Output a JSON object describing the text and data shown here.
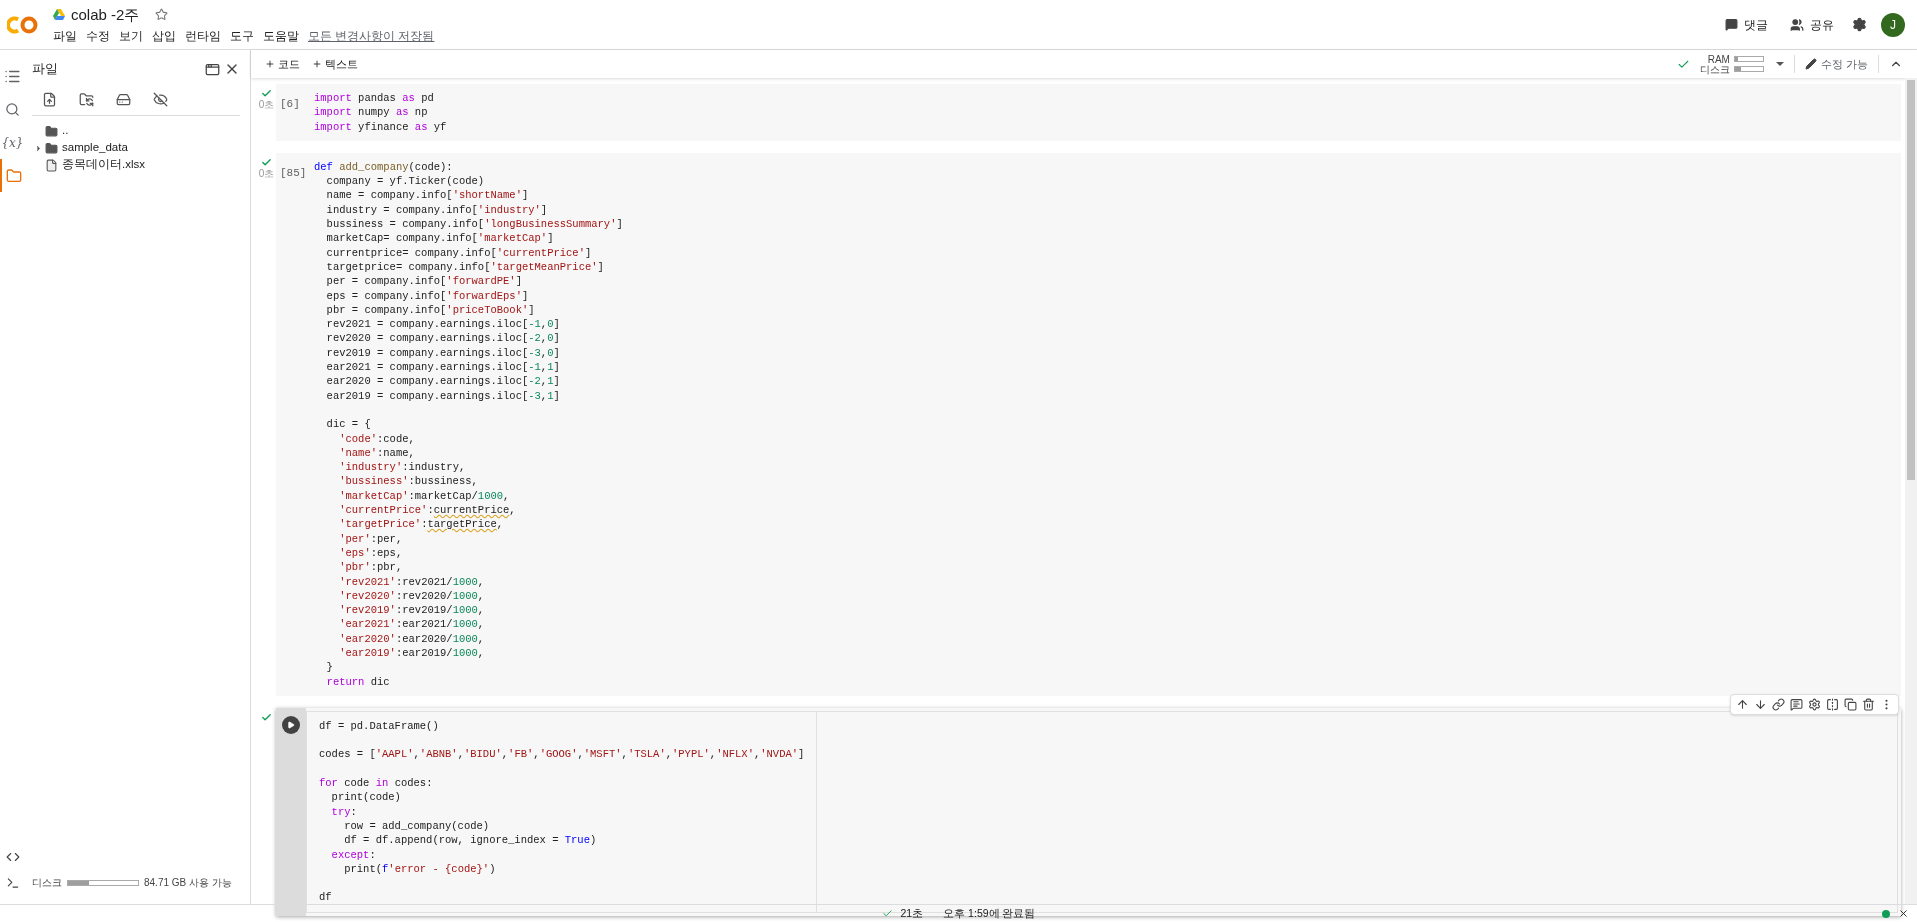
{
  "header": {
    "title": "colab -2주",
    "starred": false,
    "menu": [
      "파일",
      "수정",
      "보기",
      "삽입",
      "런타임",
      "도구",
      "도움말"
    ],
    "save_status": "모든 변경사항이 저장됨",
    "actions": [
      {
        "kind": "comment",
        "label": "댓글"
      },
      {
        "kind": "share",
        "label": "공유"
      }
    ],
    "avatar": "J"
  },
  "rail": [
    {
      "kind": "toc",
      "selected": false
    },
    {
      "kind": "search",
      "selected": false
    },
    {
      "kind": "vars",
      "glyph": "{x}",
      "selected": false
    },
    {
      "kind": "files",
      "selected": true
    }
  ],
  "file_panel": {
    "title": "파일",
    "tree": [
      {
        "kind": "parent",
        "name": ".."
      },
      {
        "kind": "folder",
        "name": "sample_data",
        "expanded": false
      },
      {
        "kind": "file",
        "name": "종목데이터.xlsx"
      }
    ],
    "disk": {
      "label": "디스크",
      "level": 0.3,
      "reading": "84.71 GB 사용 가능"
    }
  },
  "toolbar": {
    "add_buttons": [
      "코드",
      "텍스트"
    ],
    "connected": true,
    "meters": [
      {
        "label": "RAM",
        "level": 0.12
      },
      {
        "label": "디스크",
        "level": 0.2
      }
    ],
    "edit_mode": "수정 가능"
  },
  "cells": [
    {
      "exec": "[6]",
      "ok": true,
      "time": "0초",
      "focused": false,
      "lines": [
        [
          {
            "kind": "kw",
            "text": "import"
          },
          {
            "kind": "plain",
            "text": " pandas "
          },
          {
            "kind": "kw",
            "text": "as"
          },
          {
            "kind": "plain",
            "text": " pd"
          }
        ],
        [
          {
            "kind": "kw",
            "text": "import"
          },
          {
            "kind": "plain",
            "text": " numpy "
          },
          {
            "kind": "kw",
            "text": "as"
          },
          {
            "kind": "plain",
            "text": " np"
          }
        ],
        [
          {
            "kind": "kw",
            "text": "import"
          },
          {
            "kind": "plain",
            "text": " yfinance "
          },
          {
            "kind": "kw",
            "text": "as"
          },
          {
            "kind": "plain",
            "text": " yf"
          }
        ]
      ]
    },
    {
      "exec": "[85]",
      "ok": true,
      "time": "0초",
      "focused": false,
      "lines": [
        [
          {
            "kind": "def",
            "text": "def "
          },
          {
            "kind": "fn",
            "text": "add_company"
          },
          {
            "kind": "plain",
            "text": "(code):"
          }
        ],
        [
          {
            "kind": "plain",
            "text": "  company = yf.Ticker(code)"
          }
        ],
        [
          {
            "kind": "plain",
            "text": "  name = company.info["
          },
          {
            "kind": "str",
            "text": "'shortName'"
          },
          {
            "kind": "plain",
            "text": "]"
          }
        ],
        [
          {
            "kind": "plain",
            "text": "  industry = company.info["
          },
          {
            "kind": "str",
            "text": "'industry'"
          },
          {
            "kind": "plain",
            "text": "]"
          }
        ],
        [
          {
            "kind": "plain",
            "text": "  bussiness = company.info["
          },
          {
            "kind": "str",
            "text": "'longBusinessSummary'"
          },
          {
            "kind": "plain",
            "text": "]"
          }
        ],
        [
          {
            "kind": "plain",
            "text": "  marketCap= company.info["
          },
          {
            "kind": "str",
            "text": "'marketCap'"
          },
          {
            "kind": "plain",
            "text": "]"
          }
        ],
        [
          {
            "kind": "plain",
            "text": "  currentprice= company.info["
          },
          {
            "kind": "str",
            "text": "'currentPrice'"
          },
          {
            "kind": "plain",
            "text": "]"
          }
        ],
        [
          {
            "kind": "plain",
            "text": "  targetprice= company.info["
          },
          {
            "kind": "str",
            "text": "'targetMeanPrice'"
          },
          {
            "kind": "plain",
            "text": "]"
          }
        ],
        [
          {
            "kind": "plain",
            "text": "  per = company.info["
          },
          {
            "kind": "str",
            "text": "'forwardPE'"
          },
          {
            "kind": "plain",
            "text": "]"
          }
        ],
        [
          {
            "kind": "plain",
            "text": "  eps = company.info["
          },
          {
            "kind": "str",
            "text": "'forwardEps'"
          },
          {
            "kind": "plain",
            "text": "]"
          }
        ],
        [
          {
            "kind": "plain",
            "text": "  pbr = company.info["
          },
          {
            "kind": "str",
            "text": "'priceToBook'"
          },
          {
            "kind": "plain",
            "text": "]"
          }
        ],
        [
          {
            "kind": "plain",
            "text": "  rev2021 = company.earnings.iloc["
          },
          {
            "kind": "num",
            "text": "-1"
          },
          {
            "kind": "plain",
            "text": ","
          },
          {
            "kind": "num",
            "text": "0"
          },
          {
            "kind": "plain",
            "text": "]"
          }
        ],
        [
          {
            "kind": "plain",
            "text": "  rev2020 = company.earnings.iloc["
          },
          {
            "kind": "num",
            "text": "-2"
          },
          {
            "kind": "plain",
            "text": ","
          },
          {
            "kind": "num",
            "text": "0"
          },
          {
            "kind": "plain",
            "text": "]"
          }
        ],
        [
          {
            "kind": "plain",
            "text": "  rev2019 = company.earnings.iloc["
          },
          {
            "kind": "num",
            "text": "-3"
          },
          {
            "kind": "plain",
            "text": ","
          },
          {
            "kind": "num",
            "text": "0"
          },
          {
            "kind": "plain",
            "text": "]"
          }
        ],
        [
          {
            "kind": "plain",
            "text": "  ear2021 = company.earnings.iloc["
          },
          {
            "kind": "num",
            "text": "-1"
          },
          {
            "kind": "plain",
            "text": ","
          },
          {
            "kind": "num",
            "text": "1"
          },
          {
            "kind": "plain",
            "text": "]"
          }
        ],
        [
          {
            "kind": "plain",
            "text": "  ear2020 = company.earnings.iloc["
          },
          {
            "kind": "num",
            "text": "-2"
          },
          {
            "kind": "plain",
            "text": ","
          },
          {
            "kind": "num",
            "text": "1"
          },
          {
            "kind": "plain",
            "text": "]"
          }
        ],
        [
          {
            "kind": "plain",
            "text": "  ear2019 = company.earnings.iloc["
          },
          {
            "kind": "num",
            "text": "-3"
          },
          {
            "kind": "plain",
            "text": ","
          },
          {
            "kind": "num",
            "text": "1"
          },
          {
            "kind": "plain",
            "text": "]"
          }
        ],
        [
          {
            "kind": "blank"
          }
        ],
        [
          {
            "kind": "plain",
            "text": "  dic = {"
          }
        ],
        [
          {
            "kind": "str",
            "text": "    'code'"
          },
          {
            "kind": "plain",
            "text": ":code,"
          }
        ],
        [
          {
            "kind": "str",
            "text": "    'name'"
          },
          {
            "kind": "plain",
            "text": ":name,"
          }
        ],
        [
          {
            "kind": "str",
            "text": "    'industry'"
          },
          {
            "kind": "plain",
            "text": ":industry,"
          }
        ],
        [
          {
            "kind": "str",
            "text": "    'bussiness'"
          },
          {
            "kind": "plain",
            "text": ":bussiness,"
          }
        ],
        [
          {
            "kind": "str",
            "text": "    'marketCap'"
          },
          {
            "kind": "plain",
            "text": ":marketCap/"
          },
          {
            "kind": "num",
            "text": "1000"
          },
          {
            "kind": "plain",
            "text": ","
          }
        ],
        [
          {
            "kind": "str",
            "text": "    'currentPrice'"
          },
          {
            "kind": "plain",
            "text": ":"
          },
          {
            "kind": "warn",
            "text": "currentPrice"
          },
          {
            "kind": "plain",
            "text": ","
          }
        ],
        [
          {
            "kind": "str",
            "text": "    'targetPrice'"
          },
          {
            "kind": "plain",
            "text": ":"
          },
          {
            "kind": "warn",
            "text": "targetPrice"
          },
          {
            "kind": "plain",
            "text": ","
          }
        ],
        [
          {
            "kind": "str",
            "text": "    'per'"
          },
          {
            "kind": "plain",
            "text": ":per,"
          }
        ],
        [
          {
            "kind": "str",
            "text": "    'eps'"
          },
          {
            "kind": "plain",
            "text": ":eps,"
          }
        ],
        [
          {
            "kind": "str",
            "text": "    'pbr'"
          },
          {
            "kind": "plain",
            "text": ":pbr,"
          }
        ],
        [
          {
            "kind": "str",
            "text": "    'rev2021'"
          },
          {
            "kind": "plain",
            "text": ":rev2021/"
          },
          {
            "kind": "num",
            "text": "1000"
          },
          {
            "kind": "plain",
            "text": ","
          }
        ],
        [
          {
            "kind": "str",
            "text": "    'rev2020'"
          },
          {
            "kind": "plain",
            "text": ":rev2020/"
          },
          {
            "kind": "num",
            "text": "1000"
          },
          {
            "kind": "plain",
            "text": ","
          }
        ],
        [
          {
            "kind": "str",
            "text": "    'rev2019'"
          },
          {
            "kind": "plain",
            "text": ":rev2019/"
          },
          {
            "kind": "num",
            "text": "1000"
          },
          {
            "kind": "plain",
            "text": ","
          }
        ],
        [
          {
            "kind": "str",
            "text": "    'ear2021'"
          },
          {
            "kind": "plain",
            "text": ":ear2021/"
          },
          {
            "kind": "num",
            "text": "1000"
          },
          {
            "kind": "plain",
            "text": ","
          }
        ],
        [
          {
            "kind": "str",
            "text": "    'ear2020'"
          },
          {
            "kind": "plain",
            "text": ":ear2020/"
          },
          {
            "kind": "num",
            "text": "1000"
          },
          {
            "kind": "plain",
            "text": ","
          }
        ],
        [
          {
            "kind": "str",
            "text": "    'ear2019'"
          },
          {
            "kind": "plain",
            "text": ":ear2019/"
          },
          {
            "kind": "num",
            "text": "1000"
          },
          {
            "kind": "plain",
            "text": ","
          }
        ],
        [
          {
            "kind": "plain",
            "text": "  }"
          }
        ],
        [
          {
            "kind": "kw",
            "text": "  return"
          },
          {
            "kind": "plain",
            "text": " dic"
          }
        ]
      ]
    },
    {
      "ok": true,
      "focused": true,
      "lines": [
        [
          {
            "kind": "plain",
            "text": "df = pd.DataFrame()"
          }
        ],
        [
          {
            "kind": "blank"
          }
        ],
        [
          {
            "kind": "plain",
            "text": "codes = ["
          },
          {
            "kind": "str",
            "text": "'AAPL'"
          },
          {
            "kind": "plain",
            "text": ","
          },
          {
            "kind": "str",
            "text": "'ABNB'"
          },
          {
            "kind": "plain",
            "text": ","
          },
          {
            "kind": "str",
            "text": "'BIDU'"
          },
          {
            "kind": "plain",
            "text": ","
          },
          {
            "kind": "str",
            "text": "'FB'"
          },
          {
            "kind": "plain",
            "text": ","
          },
          {
            "kind": "str",
            "text": "'GOOG'"
          },
          {
            "kind": "plain",
            "text": ","
          },
          {
            "kind": "str",
            "text": "'MSFT'"
          },
          {
            "kind": "plain",
            "text": ","
          },
          {
            "kind": "str",
            "text": "'TSLA'"
          },
          {
            "kind": "plain",
            "text": ","
          },
          {
            "kind": "str",
            "text": "'PYPL'"
          },
          {
            "kind": "plain",
            "text": ","
          },
          {
            "kind": "str",
            "text": "'NFLX'"
          },
          {
            "kind": "plain",
            "text": ","
          },
          {
            "kind": "str",
            "text": "'NVDA'"
          },
          {
            "kind": "plain",
            "text": "]"
          }
        ],
        [
          {
            "kind": "blank"
          }
        ],
        [
          {
            "kind": "kw",
            "text": "for"
          },
          {
            "kind": "plain",
            "text": " code "
          },
          {
            "kind": "kw",
            "text": "in"
          },
          {
            "kind": "plain",
            "text": " codes:"
          }
        ],
        [
          {
            "kind": "plain",
            "text": "  print(code)"
          }
        ],
        [
          {
            "kind": "kw",
            "text": "  try"
          },
          {
            "kind": "plain",
            "text": ":"
          }
        ],
        [
          {
            "kind": "plain",
            "text": "    row = add_company(code)"
          }
        ],
        [
          {
            "kind": "plain",
            "text": "    df = df.append(row, ignore_index = "
          },
          {
            "kind": "const",
            "text": "True"
          },
          {
            "kind": "plain",
            "text": ")"
          }
        ],
        [
          {
            "kind": "kw",
            "text": "  except"
          },
          {
            "kind": "plain",
            "text": ":"
          }
        ],
        [
          {
            "kind": "plain",
            "text": "    print("
          },
          {
            "kind": "def",
            "text": "f"
          },
          {
            "kind": "str",
            "text": "'error - {code}'"
          },
          {
            "kind": "plain",
            "text": ")"
          }
        ],
        [
          {
            "kind": "blank"
          }
        ],
        [
          {
            "kind": "plain",
            "text": "df"
          }
        ]
      ]
    }
  ],
  "status_bar": {
    "ok": true,
    "duration": "21초",
    "message": "오후 1:59에 완료됨",
    "connected": true
  }
}
